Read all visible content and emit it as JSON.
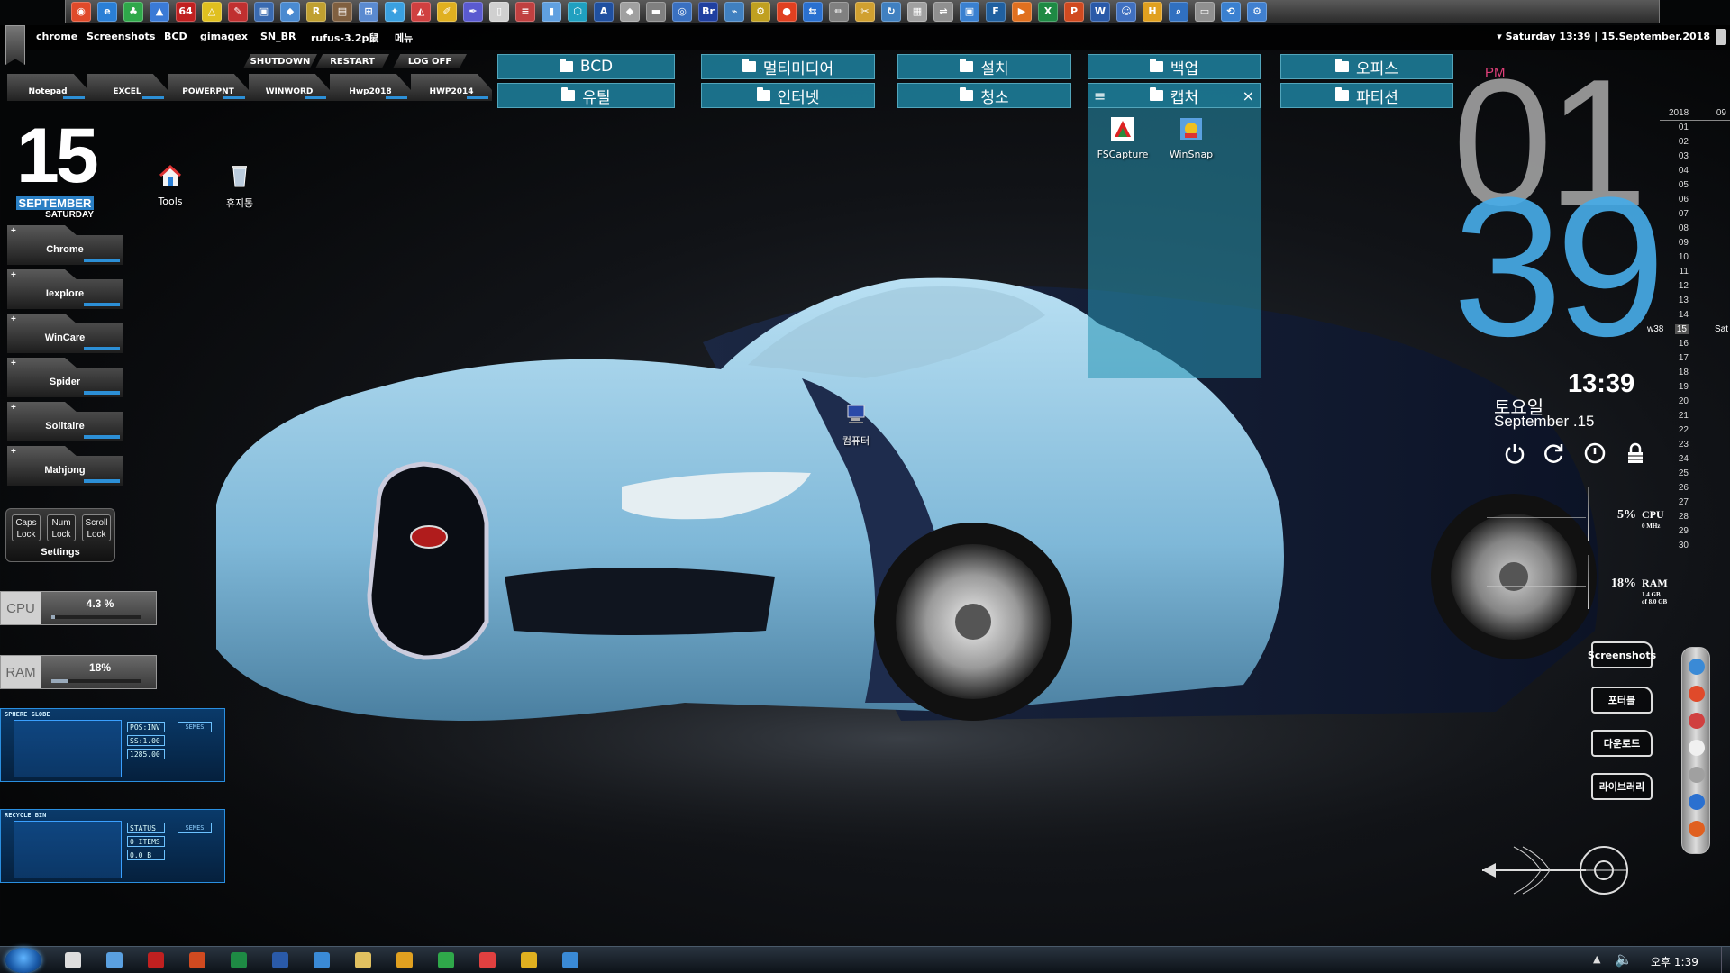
{
  "top_launcher": {
    "icons": [
      {
        "name": "chrome-icon",
        "color": "#e04a2a",
        "glyph": "◉"
      },
      {
        "name": "ie-icon",
        "color": "#2a7fd6",
        "glyph": "e"
      },
      {
        "name": "clover-icon",
        "color": "#2fa84a",
        "glyph": "♣"
      },
      {
        "name": "drive-icon",
        "color": "#3a7ad6",
        "glyph": "▲"
      },
      {
        "name": "x64-icon",
        "color": "#c02020",
        "glyph": "64"
      },
      {
        "name": "triangle-warning-icon",
        "color": "#e0c020",
        "glyph": "△"
      },
      {
        "name": "tool-icon",
        "color": "#c03030",
        "glyph": "✎"
      },
      {
        "name": "monitor-icon",
        "color": "#3a6ab0",
        "glyph": "▣"
      },
      {
        "name": "drop-icon",
        "color": "#4a8ad0",
        "glyph": "◆"
      },
      {
        "name": "rar-icon",
        "color": "#c0a030",
        "glyph": "R"
      },
      {
        "name": "archive-icon",
        "color": "#806040",
        "glyph": "▤"
      },
      {
        "name": "network-icon",
        "color": "#5a8ad0",
        "glyph": "⊞"
      },
      {
        "name": "bird-icon",
        "color": "#3aa0e0",
        "glyph": "✦"
      },
      {
        "name": "paint-icon",
        "color": "#d04040",
        "glyph": "◭"
      },
      {
        "name": "brush-icon",
        "color": "#e0b020",
        "glyph": "✐"
      },
      {
        "name": "pen-icon",
        "color": "#5a5ad0",
        "glyph": "✒"
      },
      {
        "name": "doc-icon",
        "color": "#d0d0d0",
        "glyph": "▯"
      },
      {
        "name": "list-icon",
        "color": "#c04040",
        "glyph": "≡"
      },
      {
        "name": "file-icon",
        "color": "#60a0e0",
        "glyph": "▮"
      },
      {
        "name": "cube-icon",
        "color": "#20a0c0",
        "glyph": "⬡"
      },
      {
        "name": "a-icon",
        "color": "#2050a0",
        "glyph": "A"
      },
      {
        "name": "diamond-icon",
        "color": "#a0a0a0",
        "glyph": "◆"
      },
      {
        "name": "car-icon",
        "color": "#808080",
        "glyph": "▬"
      },
      {
        "name": "globe-icon",
        "color": "#3a70c0",
        "glyph": "◎"
      },
      {
        "name": "br-icon",
        "color": "#2040a0",
        "glyph": "Br"
      },
      {
        "name": "ship-icon",
        "color": "#4080c0",
        "glyph": "⌁"
      },
      {
        "name": "gear-icon",
        "color": "#c0a020",
        "glyph": "⚙"
      },
      {
        "name": "record-icon",
        "color": "#e04020",
        "glyph": "●"
      },
      {
        "name": "teamviewer-icon",
        "color": "#2a70d0",
        "glyph": "⇆"
      },
      {
        "name": "pencil-icon",
        "color": "#808080",
        "glyph": "✏"
      },
      {
        "name": "tools-icon",
        "color": "#d0a030",
        "glyph": "✂"
      },
      {
        "name": "refresh-icon",
        "color": "#4080c0",
        "glyph": "↻"
      },
      {
        "name": "window-icon",
        "color": "#a0a0a0",
        "glyph": "▦"
      },
      {
        "name": "usb-icon",
        "color": "#909090",
        "glyph": "⇌"
      },
      {
        "name": "control-icon",
        "color": "#3a80d0",
        "glyph": "▣"
      },
      {
        "name": "f-icon",
        "color": "#2060a0",
        "glyph": "F"
      },
      {
        "name": "media-icon",
        "color": "#e07020",
        "glyph": "▶"
      },
      {
        "name": "excel-icon",
        "color": "#1e8a44",
        "glyph": "X"
      },
      {
        "name": "ppt-icon",
        "color": "#d04a20",
        "glyph": "P"
      },
      {
        "name": "word-icon",
        "color": "#2a5aa8",
        "glyph": "W"
      },
      {
        "name": "people-icon",
        "color": "#4070c0",
        "glyph": "☺"
      },
      {
        "name": "hwp-icon",
        "color": "#e0a020",
        "glyph": "H"
      },
      {
        "name": "search-icon",
        "color": "#3070c0",
        "glyph": "⌕"
      },
      {
        "name": "display-icon",
        "color": "#909090",
        "glyph": "▭"
      },
      {
        "name": "backup-icon",
        "color": "#3a80d0",
        "glyph": "⟲"
      },
      {
        "name": "settings-icon",
        "color": "#4080d0",
        "glyph": "⚙"
      }
    ]
  },
  "menu_bar": {
    "items": [
      "chrome",
      "Screenshots",
      "BCD",
      "gimagex",
      "SN_BR",
      "rufus-3.2p鼠",
      "메뉴"
    ],
    "datetime": "▾ Saturday 13:39 | 15.September.2018"
  },
  "power_tabs": [
    "SHUTDOWN",
    "RESTART",
    "LOG OFF"
  ],
  "program_tabs": [
    "Notepad",
    "EXCEL",
    "POWERPNT",
    "WINWORD",
    "Hwp2018",
    "HWP2014"
  ],
  "date_widget": {
    "day": "15",
    "month": "SEPTEMBER",
    "weekday": "SATURDAY"
  },
  "side_tiles": [
    "Chrome",
    "Iexplore",
    "WinCare",
    "Spider",
    "Solitaire",
    "Mahjong"
  ],
  "lock_keys": {
    "keys": [
      "Caps Lock",
      "Num Lock",
      "Scroll Lock"
    ],
    "settings": "Settings"
  },
  "meters": {
    "cpu": {
      "label": "CPU",
      "value": "4.3 %",
      "fill": 0.043
    },
    "ram": {
      "label": "RAM",
      "value": "18%",
      "fill": 0.18
    }
  },
  "hud_panels": {
    "sphere": {
      "title": "SPHERE GLOBE",
      "fields": [
        "POS:INV",
        "SS:1.00",
        "1285.00"
      ],
      "button": "SEMES"
    },
    "recycle": {
      "title": "RECYCLE BIN",
      "fields": [
        "STATUS",
        "0 ITEMS",
        "0.0 B"
      ],
      "button": "SEMES"
    }
  },
  "desktop_icons": [
    {
      "label": "Tools"
    },
    {
      "label": "휴지통"
    },
    {
      "label": "컴퓨터"
    }
  ],
  "fences": {
    "row1": [
      "BCD",
      "멀티미디어",
      "설치",
      "백업",
      "오피스"
    ],
    "row2": [
      "유틸",
      "인터넷",
      "청소",
      "캡처",
      "파티션"
    ],
    "capture_apps": [
      "FSCapture",
      "WinSnap"
    ]
  },
  "clock": {
    "ampm": "PM",
    "hour": "01",
    "minute": "39",
    "digital": "13:39",
    "weekday_kr": "토요일",
    "date": "September .15"
  },
  "calendar": {
    "year": "2018",
    "month": "09",
    "week": "w38",
    "today": 15,
    "today_weekday": "Sat",
    "days": [
      "01",
      "02",
      "03",
      "04",
      "05",
      "06",
      "07",
      "08",
      "09",
      "10",
      "11",
      "12",
      "13",
      "14",
      "15",
      "16",
      "17",
      "18",
      "19",
      "20",
      "21",
      "22",
      "23",
      "24",
      "25",
      "26",
      "27",
      "28",
      "29",
      "30"
    ]
  },
  "system_monitor": {
    "cpu": {
      "pct": "5%",
      "name": "CPU",
      "sub": "0 MHz"
    },
    "ram": {
      "pct": "18%",
      "name": "RAM",
      "sub1": "1.4 GB",
      "sub2": "of 8.0 GB"
    }
  },
  "right_shortcuts": [
    "Screenshots",
    "포터블",
    "다운로드",
    "라이브러리"
  ],
  "right_dock_colors": [
    "#3a8ad6",
    "#e04a2a",
    "#d04040",
    "#f0f0f0",
    "#a0a0a0",
    "#2a70d0",
    "#e06020"
  ],
  "taskbar": {
    "icons": [
      {
        "name": "tiles-icon",
        "color": "#ddd"
      },
      {
        "name": "pen-tool-icon",
        "color": "#5aa0e0"
      },
      {
        "name": "pdf-icon",
        "color": "#c02020"
      },
      {
        "name": "powerpoint-icon",
        "color": "#d04a20"
      },
      {
        "name": "excel-taskbar-icon",
        "color": "#1e8a44"
      },
      {
        "name": "word-taskbar-icon",
        "color": "#2a5aa8"
      },
      {
        "name": "calculator-icon",
        "color": "#3a8ad6"
      },
      {
        "name": "folder-icon",
        "color": "#e0c060"
      },
      {
        "name": "player-icon",
        "color": "#e0a020"
      },
      {
        "name": "clover-taskbar-icon",
        "color": "#2fa84a"
      },
      {
        "name": "brush-taskbar-icon",
        "color": "#e04040"
      },
      {
        "name": "chrome-taskbar-icon",
        "color": "#e0b020"
      },
      {
        "name": "ie-taskbar-icon",
        "color": "#3a8ad6"
      }
    ],
    "clock": "오후 1:39"
  }
}
